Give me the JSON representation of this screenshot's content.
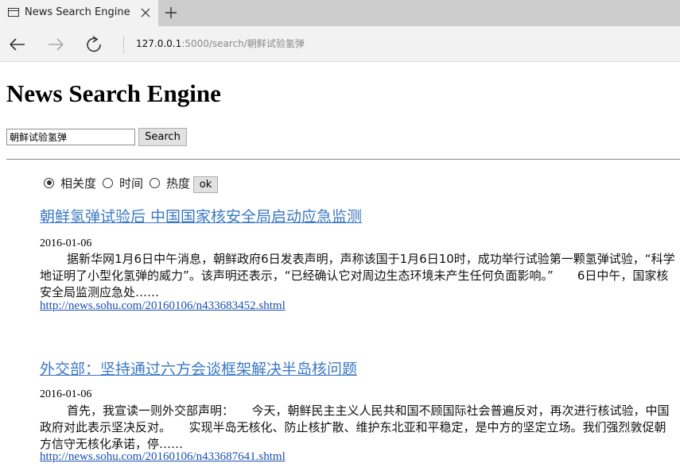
{
  "browser": {
    "tab_title": "News Search Engine",
    "address_host": "127.0.0.1",
    "address_path": ":5000/search/朝鲜试验氢弹"
  },
  "page": {
    "heading": "News Search Engine",
    "search_value": "朝鲜试验氢弹",
    "search_button": "Search",
    "sort_options": [
      {
        "label": "相关度",
        "checked": true
      },
      {
        "label": "时间",
        "checked": false
      },
      {
        "label": "热度",
        "checked": false
      }
    ],
    "ok_button": "ok"
  },
  "results": [
    {
      "title": "朝鲜氢弹试验后 中国国家核安全局启动应急监测",
      "date": "2016-01-06",
      "snippet": "据新华网1月6日中午消息，朝鲜政府6日发表声明，声称该国于1月6日10时，成功举行试验第一颗氢弹试验，“科学地证明了小型化氢弹的威力”。该声明还表示，“已经确认它对周边生态环境未产生任何负面影响。”　　6日中午，国家核安全局监测应急处……",
      "url": "http://news.sohu.com/20160106/n433683452.shtml"
    },
    {
      "title": "外交部：坚持通过六方会谈框架解决半岛核问题",
      "date": "2016-01-06",
      "snippet": "首先，我宣读一则外交部声明：　　今天，朝鲜民主主义人民共和国不顾国际社会普遍反对，再次进行核试验，中国政府对此表示坚决反对。　　实现半岛无核化、防止核扩散、维护东北亚和平稳定，是中方的坚定立场。我们强烈敦促朝方信守无核化承诺，停……",
      "url": "http://news.sohu.com/20160106/n433687641.shtml"
    }
  ]
}
